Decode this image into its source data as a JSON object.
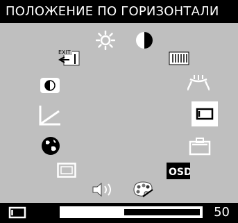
{
  "title": "ПОЛОЖЕНИЕ ПО ГОРИЗОНТАЛИ",
  "menu": {
    "icons": [
      {
        "name": "brightness-icon"
      },
      {
        "name": "contrast-icon"
      },
      {
        "name": "exit-icon",
        "label": "EXIT"
      },
      {
        "name": "moire-icon"
      },
      {
        "name": "color-temperature-icon"
      },
      {
        "name": "pincushion-icon"
      },
      {
        "name": "gamma-icon"
      },
      {
        "name": "horizontal-position-icon",
        "selected": true
      },
      {
        "name": "language-icon"
      },
      {
        "name": "vertical-position-icon"
      },
      {
        "name": "size-icon"
      },
      {
        "name": "osd-settings-icon",
        "label": "OSD"
      },
      {
        "name": "volume-icon"
      },
      {
        "name": "color-palette-icon"
      }
    ]
  },
  "footer": {
    "icon": "horizontal-position-icon",
    "level": 0.45,
    "value": "50"
  },
  "colors": {
    "background": "#bfbfbf",
    "bar": "#000000",
    "selected": "#ffffff"
  }
}
